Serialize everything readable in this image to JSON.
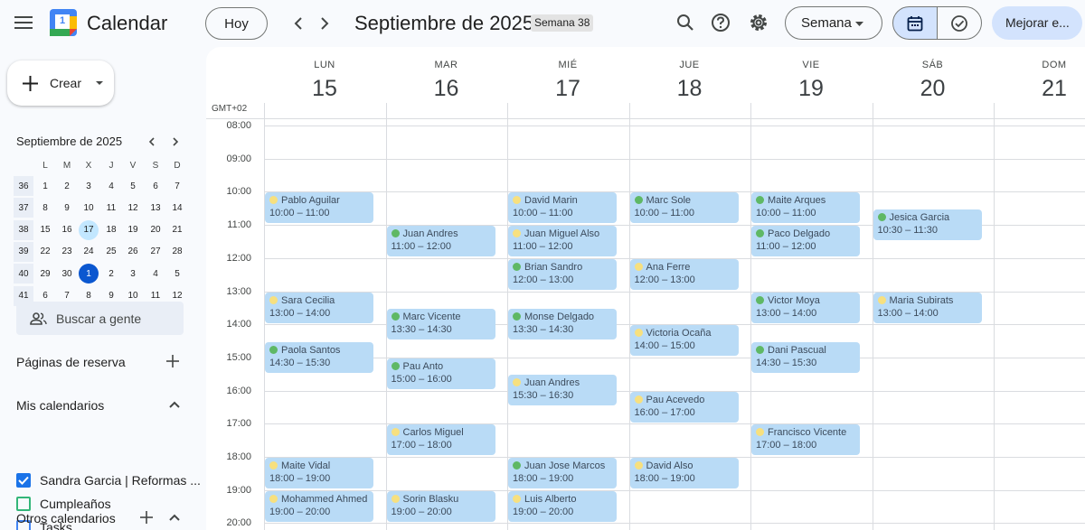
{
  "header": {
    "app_title": "Calendar",
    "logo_day": "1",
    "today_label": "Hoy",
    "period_title": "Septiembre de 2025",
    "week_badge": "Semana 38",
    "view_label": "Semana",
    "upgrade_label": "Mejorar e..."
  },
  "sidebar": {
    "create_label": "Crear",
    "mini_cal": {
      "title": "Septiembre de 2025",
      "weekday_heads": [
        "L",
        "M",
        "X",
        "J",
        "V",
        "S",
        "D"
      ],
      "weeks": [
        {
          "wk": "36",
          "days": [
            "1",
            "2",
            "3",
            "4",
            "5",
            "6",
            "7"
          ]
        },
        {
          "wk": "37",
          "days": [
            "8",
            "9",
            "10",
            "11",
            "12",
            "13",
            "14"
          ]
        },
        {
          "wk": "38",
          "days": [
            "15",
            "16",
            "17",
            "18",
            "19",
            "20",
            "21"
          ]
        },
        {
          "wk": "39",
          "days": [
            "22",
            "23",
            "24",
            "25",
            "26",
            "27",
            "28"
          ]
        },
        {
          "wk": "40",
          "days": [
            "29",
            "30",
            "1",
            "2",
            "3",
            "4",
            "5"
          ]
        },
        {
          "wk": "41",
          "days": [
            "6",
            "7",
            "8",
            "9",
            "10",
            "11",
            "12"
          ]
        }
      ]
    },
    "search_people": "Buscar a gente",
    "booking_pages": "Páginas de reserva",
    "my_calendars": "Mis calendarios",
    "calendars": [
      {
        "label": "Sandra Garcia | Reformas ...",
        "checked": true,
        "color": "#1a73e8"
      },
      {
        "label": "Cumpleaños",
        "checked": false,
        "color": "#33b679"
      },
      {
        "label": "Tasks",
        "checked": false,
        "color": "#4285f4"
      }
    ],
    "other_calendars": "Otros calendarios"
  },
  "grid": {
    "timezone": "GMT+02",
    "days": [
      {
        "name": "LUN",
        "num": "15"
      },
      {
        "name": "MAR",
        "num": "16"
      },
      {
        "name": "MIÉ",
        "num": "17"
      },
      {
        "name": "JUE",
        "num": "18"
      },
      {
        "name": "VIE",
        "num": "19"
      },
      {
        "name": "SÁB",
        "num": "20"
      },
      {
        "name": "DOM",
        "num": "21"
      }
    ],
    "hours": [
      "08:00",
      "09:00",
      "10:00",
      "11:00",
      "12:00",
      "13:00",
      "14:00",
      "15:00",
      "16:00",
      "17:00",
      "18:00",
      "19:00",
      "20:00"
    ],
    "events": [
      {
        "day": 0,
        "start": 10,
        "title": "Pablo Aguilar",
        "time": "10:00 – 11:00",
        "dot": "y"
      },
      {
        "day": 0,
        "start": 13,
        "title": "Sara Cecilia",
        "time": "13:00 – 14:00",
        "dot": "y"
      },
      {
        "day": 0,
        "start": 14.5,
        "title": "Paola Santos",
        "time": "14:30 – 15:30",
        "dot": "g"
      },
      {
        "day": 0,
        "start": 18,
        "title": "Maite Vidal",
        "time": "18:00 – 19:00",
        "dot": "y"
      },
      {
        "day": 0,
        "start": 19,
        "title": "Mohammed Ahmed",
        "time": "19:00 – 20:00",
        "dot": "y"
      },
      {
        "day": 1,
        "start": 11,
        "title": "Juan Andres",
        "time": "11:00 – 12:00",
        "dot": "g"
      },
      {
        "day": 1,
        "start": 13.5,
        "title": "Marc Vicente",
        "time": "13:30 – 14:30",
        "dot": "g"
      },
      {
        "day": 1,
        "start": 15,
        "title": "Pau Anto",
        "time": "15:00 – 16:00",
        "dot": "g"
      },
      {
        "day": 1,
        "start": 17,
        "title": "Carlos Miguel",
        "time": "17:00 – 18:00",
        "dot": "y"
      },
      {
        "day": 1,
        "start": 19,
        "title": "Sorin Blasku",
        "time": "19:00 – 20:00",
        "dot": "y"
      },
      {
        "day": 2,
        "start": 10,
        "title": "David Marin",
        "time": "10:00 – 11:00",
        "dot": "y"
      },
      {
        "day": 2,
        "start": 11,
        "title": "Juan Miguel Also",
        "time": "11:00 – 12:00",
        "dot": "y"
      },
      {
        "day": 2,
        "start": 12,
        "title": "Brian Sandro",
        "time": "12:00 – 13:00",
        "dot": "g"
      },
      {
        "day": 2,
        "start": 13.5,
        "title": "Monse Delgado",
        "time": "13:30 – 14:30",
        "dot": "g"
      },
      {
        "day": 2,
        "start": 15.5,
        "title": "Juan Andres",
        "time": "15:30 – 16:30",
        "dot": "y"
      },
      {
        "day": 2,
        "start": 18,
        "title": "Juan Jose Marcos",
        "time": "18:00 – 19:00",
        "dot": "g"
      },
      {
        "day": 2,
        "start": 19,
        "title": "Luis Alberto",
        "time": "19:00 – 20:00",
        "dot": "y"
      },
      {
        "day": 3,
        "start": 10,
        "title": "Marc Sole",
        "time": "10:00 – 11:00",
        "dot": "g"
      },
      {
        "day": 3,
        "start": 12,
        "title": "Ana Ferre",
        "time": "12:00 – 13:00",
        "dot": "y"
      },
      {
        "day": 3,
        "start": 14,
        "title": "Victoria Ocaña",
        "time": "14:00 – 15:00",
        "dot": "y"
      },
      {
        "day": 3,
        "start": 16,
        "title": "Pau Acevedo",
        "time": "16:00 – 17:00",
        "dot": "y"
      },
      {
        "day": 3,
        "start": 18,
        "title": "David Also",
        "time": "18:00 – 19:00",
        "dot": "y"
      },
      {
        "day": 4,
        "start": 10,
        "title": "Maite Arques",
        "time": "10:00 – 11:00",
        "dot": "g"
      },
      {
        "day": 4,
        "start": 11,
        "title": "Paco Delgado",
        "time": "11:00 – 12:00",
        "dot": "g"
      },
      {
        "day": 4,
        "start": 13,
        "title": "Victor Moya",
        "time": "13:00 – 14:00",
        "dot": "g"
      },
      {
        "day": 4,
        "start": 14.5,
        "title": "Dani Pascual",
        "time": "14:30 – 15:30",
        "dot": "g"
      },
      {
        "day": 4,
        "start": 17,
        "title": "Francisco Vicente",
        "time": "17:00 – 18:00",
        "dot": "y"
      },
      {
        "day": 5,
        "start": 10.5,
        "title": "Jesica Garcia",
        "time": "10:30 – 11:30",
        "dot": "g"
      },
      {
        "day": 5,
        "start": 13,
        "title": "Maria Subirats",
        "time": "13:00 – 14:00",
        "dot": "y"
      }
    ]
  },
  "colors": {
    "accent": "#0b57d0",
    "event_bg": "#b9dbf6",
    "today_mini": "#c2e7ff"
  }
}
